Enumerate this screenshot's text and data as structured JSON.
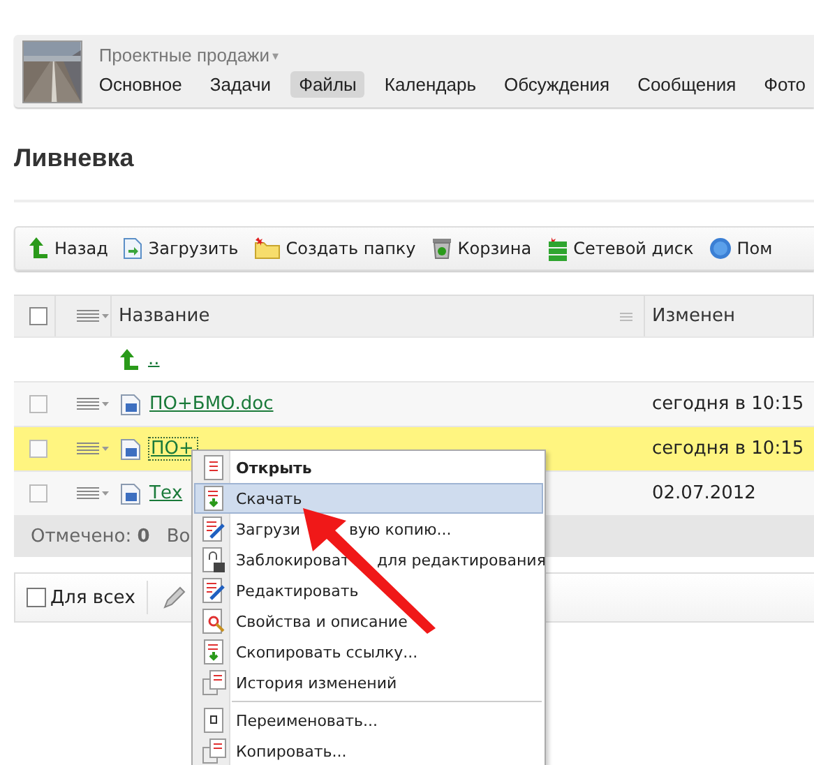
{
  "group": {
    "name": "Проектные продажи",
    "caret": "▾"
  },
  "tabs": [
    {
      "label": "Основное",
      "selected": false
    },
    {
      "label": "Задачи",
      "selected": false
    },
    {
      "label": "Файлы",
      "selected": true
    },
    {
      "label": "Календарь",
      "selected": false
    },
    {
      "label": "Обсуждения",
      "selected": false
    },
    {
      "label": "Сообщения",
      "selected": false
    },
    {
      "label": "Фото",
      "selected": false
    }
  ],
  "page_title": "Ливневка",
  "toolbar": [
    {
      "label": "Назад",
      "kind": "back"
    },
    {
      "label": "Загрузить",
      "kind": "upload"
    },
    {
      "label": "Создать папку",
      "kind": "folder"
    },
    {
      "label": "Корзина",
      "kind": "trash"
    },
    {
      "label": "Сетевой диск",
      "kind": "disk"
    },
    {
      "label": "Пом",
      "kind": "help"
    }
  ],
  "table": {
    "select_all": {
      "checked": false
    },
    "columns": [
      "Название",
      "Изменен"
    ],
    "rows": [
      {
        "kind": "parent",
        "name": ".."
      },
      {
        "kind": "file",
        "name": "ПО+БМО.doc",
        "modified": "сегодня в 10:15",
        "checked": false,
        "highlighted": false
      },
      {
        "kind": "file",
        "name": "ПО+",
        "modified": "сегодня в 10:15",
        "checked": false,
        "highlighted": true
      },
      {
        "kind": "file",
        "name": "Тех",
        "modified": "02.07.2012",
        "checked": false,
        "highlighted": false
      }
    ],
    "footer": [
      "Отмечено: **0**",
      "Во"
    ]
  },
  "bottom_bar": {
    "label": "Для всех",
    "checked": false
  },
  "context_menu": [
    {
      "label": "Открыть",
      "kind": "open",
      "default": true,
      "selected": false,
      "separator_before": false
    },
    {
      "label": "Скачать",
      "kind": "download",
      "default": false,
      "selected": true,
      "separator_before": false
    },
    {
      "label": "Загрузи",
      "label_tail": "вую копию...",
      "kind": "edit",
      "default": false,
      "selected": false,
      "separator_before": false
    },
    {
      "label": "Заблокироват",
      "label_tail": "для редактирования",
      "kind": "lock",
      "default": false,
      "selected": false,
      "separator_before": false
    },
    {
      "label": "Редактировать",
      "kind": "edit",
      "default": false,
      "selected": false,
      "separator_before": false
    },
    {
      "label": "Свойства и описание",
      "kind": "props",
      "default": false,
      "selected": false,
      "separator_before": false
    },
    {
      "label": "Скопировать ссылку...",
      "kind": "download",
      "default": false,
      "selected": false,
      "separator_before": false
    },
    {
      "label": "История изменений",
      "kind": "history",
      "default": false,
      "selected": false,
      "separator_before": false
    },
    {
      "label": "Переименовать...",
      "kind": "rename",
      "default": false,
      "selected": false,
      "separator_before": true
    },
    {
      "label": "Копировать...",
      "kind": "history",
      "default": false,
      "selected": false,
      "separator_before": false
    }
  ]
}
